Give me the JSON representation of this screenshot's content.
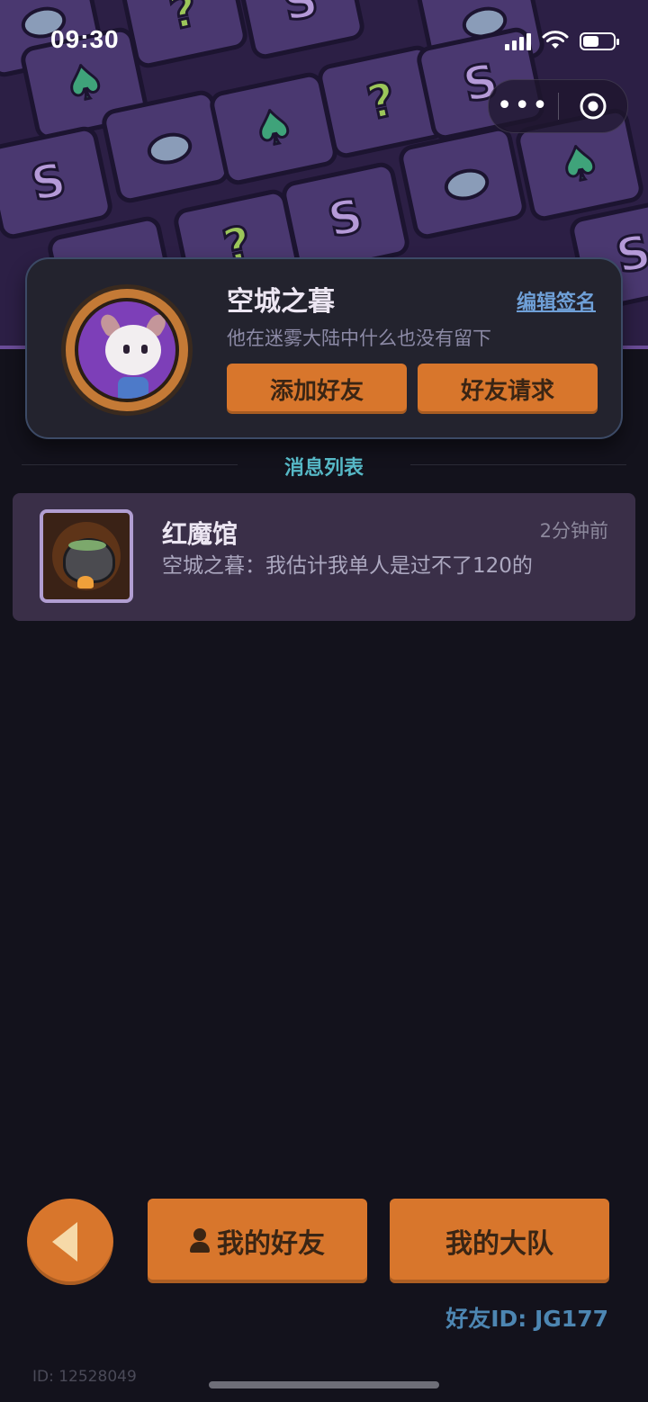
{
  "status_bar": {
    "time": "09:30",
    "icons": [
      "signal-icon",
      "wifi-icon",
      "battery-icon"
    ]
  },
  "mini_program_capsule": {
    "more_label": "•••",
    "icons": [
      "more-icon",
      "close-target-icon"
    ]
  },
  "profile": {
    "name": "空城之暮",
    "edit_signature_label": "编辑签名",
    "signature": "他在迷雾大陆中什么也没有留下",
    "add_friend_label": "添加好友",
    "friend_requests_label": "好友请求"
  },
  "messages": {
    "section_title": "消息列表",
    "items": [
      {
        "title": "红魔馆",
        "time": "2分钟前",
        "preview": "空城之暮：我估计我单人是过不了120的"
      }
    ]
  },
  "bottom_bar": {
    "my_friends_label": "我的好友",
    "my_team_label": "我的大队",
    "friend_id": "好友ID: JG177",
    "user_id": "ID: 12528049"
  },
  "colors": {
    "accent_orange": "#d8762c",
    "background": "#13121c",
    "card": "#23232e",
    "message_row": "#3a2f48",
    "section_title": "#56b8c6",
    "link": "#6fa0d8"
  }
}
